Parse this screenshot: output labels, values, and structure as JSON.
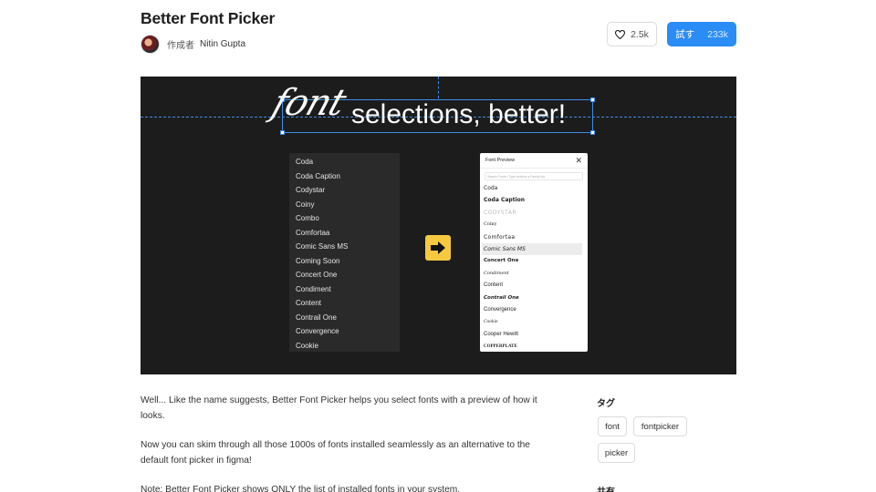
{
  "plugin": {
    "title": "Better Font Picker",
    "author_label": "作成者",
    "author_name": "Nitin Gupta"
  },
  "actions": {
    "like_count": "2.5k",
    "try_label": "試す",
    "try_count": "233k"
  },
  "hero": {
    "script_word": "font",
    "headline": "selections, better!",
    "font_list": [
      "Coda",
      "Coda Caption",
      "Codystar",
      "Coiny",
      "Combo",
      "Comfortaa",
      "Comic Sans MS",
      "Coming Soon",
      "Concert One",
      "Condiment",
      "Content",
      "Contrail One",
      "Convergence",
      "Cookie"
    ],
    "preview_title": "Font Preview",
    "preview_search_placeholder": "Search Fonts / Type actions a Family list",
    "preview_fonts": [
      "Coda",
      "Coda Caption",
      "CODYSTAR",
      "Coiny",
      "Comfortaa",
      "Comic Sans MS",
      "Concert One",
      "Condiment",
      "Content",
      "Contrail One",
      "Convergence",
      "Cookie",
      "Cooper Hewitt",
      "COPPERPLATE"
    ],
    "preview_highlighted": "Comic Sans MS"
  },
  "description": {
    "p1": "Well... Like the name suggests, Better Font Picker helps you select fonts with a preview of how it looks.",
    "p2": "Now you can skim through all those 1000s of fonts installed seamlessly as an alternative to the default font picker in figma!",
    "p3": "Note: Better Font Picker shows ONLY the list of installed fonts in your system."
  },
  "sidebar": {
    "tags_label": "タグ",
    "tags": [
      "font",
      "fontpicker",
      "picker"
    ],
    "share_label": "共有"
  }
}
